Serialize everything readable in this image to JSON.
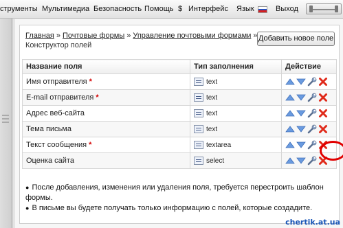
{
  "menubar": {
    "items": [
      "струменты",
      "Мультимедиа",
      "Безопасность",
      "Помощь",
      "$",
      "Интерфейс",
      "Язык",
      "Выход"
    ]
  },
  "breadcrumb": {
    "links": [
      "Главная",
      "Почтовые формы",
      "Управление почтовыми формами"
    ],
    "current": "Конструктор полей"
  },
  "add_button": "Добавить новое поле",
  "table": {
    "headers": [
      "Название поля",
      "Тип заполнения",
      "Действие"
    ],
    "rows": [
      {
        "name": "Имя отправителя",
        "required": true,
        "type": "text"
      },
      {
        "name": "E-mail отправителя",
        "required": true,
        "type": "text"
      },
      {
        "name": "Адрес веб-сайта",
        "required": false,
        "type": "text"
      },
      {
        "name": "Тема письма",
        "required": false,
        "type": "text"
      },
      {
        "name": "Текст сообщения",
        "required": true,
        "type": "textarea"
      },
      {
        "name": "Оценка сайта",
        "required": false,
        "type": "select"
      }
    ],
    "required_mark": "*"
  },
  "notes": [
    "После добавления, изменения или удаления поля, требуется перестроить шаблон формы.",
    "В письме вы будете получать только информацию с полей, которые создадите."
  ],
  "watermark": "chertik.at.ua",
  "colors": {
    "required": "#d40000",
    "delete": "#e02a1a",
    "arrow": "#6a9be0",
    "highlight": "#e10000"
  }
}
